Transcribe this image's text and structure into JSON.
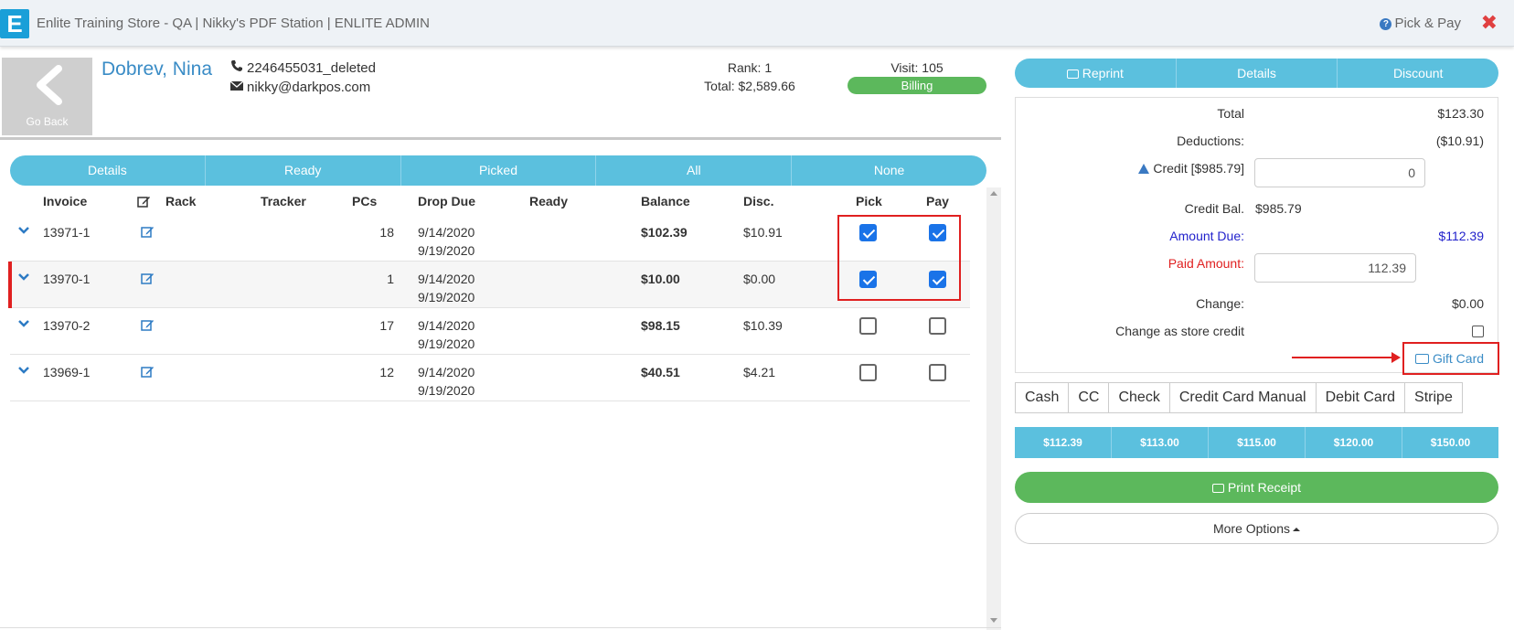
{
  "app": {
    "logo_letter": "E",
    "title": "Enlite Training Store - QA | Nikky's PDF Station | ENLITE ADMIN",
    "pick_pay": "Pick & Pay",
    "close_glyph": "✖"
  },
  "customer": {
    "go_back": "Go Back",
    "name": "Dobrev, Nina",
    "phone": "2246455031_deleted",
    "email": "nikky@darkpos.com",
    "rank": "Rank: 1",
    "total": "Total: $2,589.66",
    "visit": "Visit: 105",
    "status": "Billing"
  },
  "filters": [
    "Details",
    "Ready",
    "Picked",
    "All",
    "None"
  ],
  "table": {
    "headers": {
      "invoice": "Invoice",
      "rack": "Rack",
      "tracker": "Tracker",
      "pcs": "PCs",
      "drop_due": "Drop Due",
      "ready": "Ready",
      "balance": "Balance",
      "disc": "Disc.",
      "pick": "Pick",
      "pay": "Pay"
    },
    "rows": [
      {
        "invoice": "13971-1",
        "pcs": "18",
        "drop": "9/14/2020",
        "due": "9/19/2020",
        "balance": "$102.39",
        "disc": "$10.91",
        "pick": true,
        "pay": true
      },
      {
        "invoice": "13970-1",
        "pcs": "1",
        "drop": "9/14/2020",
        "due": "9/19/2020",
        "balance": "$10.00",
        "disc": "$0.00",
        "pick": true,
        "pay": true
      },
      {
        "invoice": "13970-2",
        "pcs": "17",
        "drop": "9/14/2020",
        "due": "9/19/2020",
        "balance": "$98.15",
        "disc": "$10.39",
        "pick": false,
        "pay": false
      },
      {
        "invoice": "13969-1",
        "pcs": "12",
        "drop": "9/14/2020",
        "due": "9/19/2020",
        "balance": "$40.51",
        "disc": "$4.21",
        "pick": false,
        "pay": false
      }
    ]
  },
  "actions": [
    "Reprint",
    "Details",
    "Discount"
  ],
  "summary": {
    "total_label": "Total",
    "total_value": "$123.30",
    "deductions_label": "Deductions:",
    "deductions_value": "($10.91)",
    "credit_label": "Credit [$985.79]",
    "credit_input": "0",
    "credit_bal_label": "Credit Bal.",
    "credit_bal_value": "$985.79",
    "amount_due_label": "Amount Due:",
    "amount_due_value": "$112.39",
    "paid_label": "Paid Amount:",
    "paid_input": "112.39",
    "change_label": "Change:",
    "change_value": "$0.00",
    "store_credit_label": "Change as store credit",
    "gift_card": "Gift Card"
  },
  "pay_types": [
    "Cash",
    "CC",
    "Check",
    "Credit Card Manual",
    "Debit Card",
    "Stripe"
  ],
  "quick_amounts": [
    "$112.39",
    "$113.00",
    "$115.00",
    "$120.00",
    "$150.00"
  ],
  "print_receipt": "Print Receipt",
  "more_options": "More Options",
  "colors": {
    "accent": "#5bc0de",
    "success": "#5cb85c",
    "highlight": "#e02020",
    "link": "#3a8cc6"
  }
}
